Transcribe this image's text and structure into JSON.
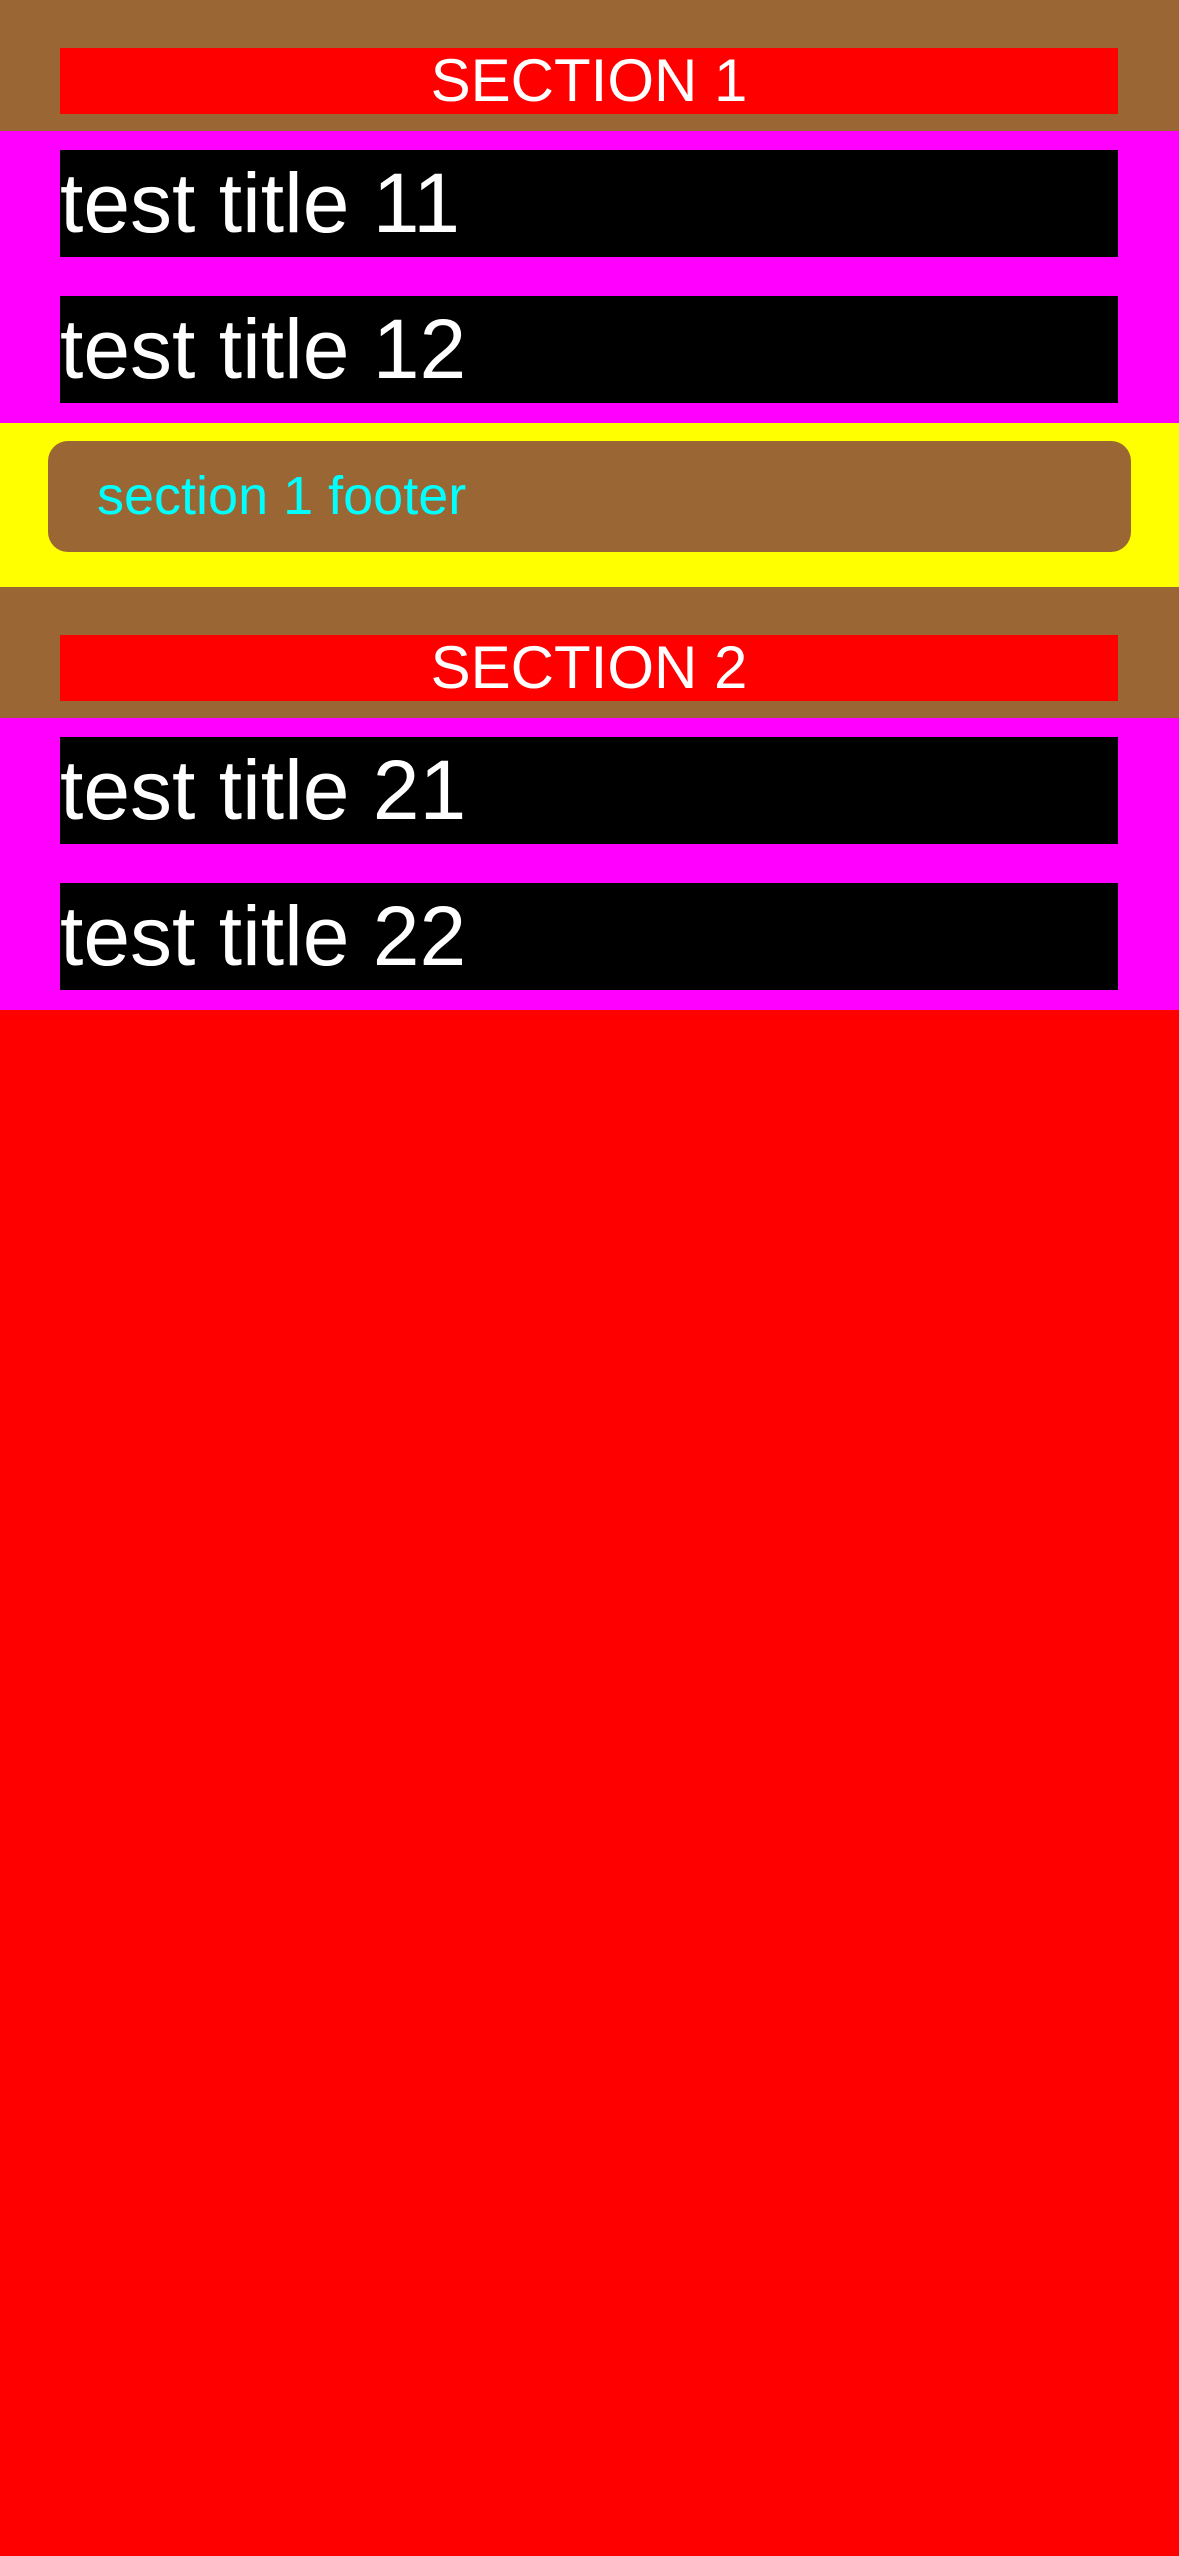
{
  "colors": {
    "background": "#FF0000",
    "section_header_background": "#9A6633",
    "section_header_label_background": "#FF0000",
    "rows_background": "#FF00FF",
    "row_background": "#000000",
    "footer_background": "#FFFF00",
    "footer_pill_background": "#9A6633",
    "footer_text": "#00FFFF",
    "text": "#FFFFFF"
  },
  "sections": [
    {
      "header": "SECTION 1",
      "rows": [
        "test title 11",
        "test title 12"
      ],
      "footer": "section 1 footer"
    },
    {
      "header": "SECTION 2",
      "rows": [
        "test title 21",
        "test title 22"
      ]
    }
  ]
}
